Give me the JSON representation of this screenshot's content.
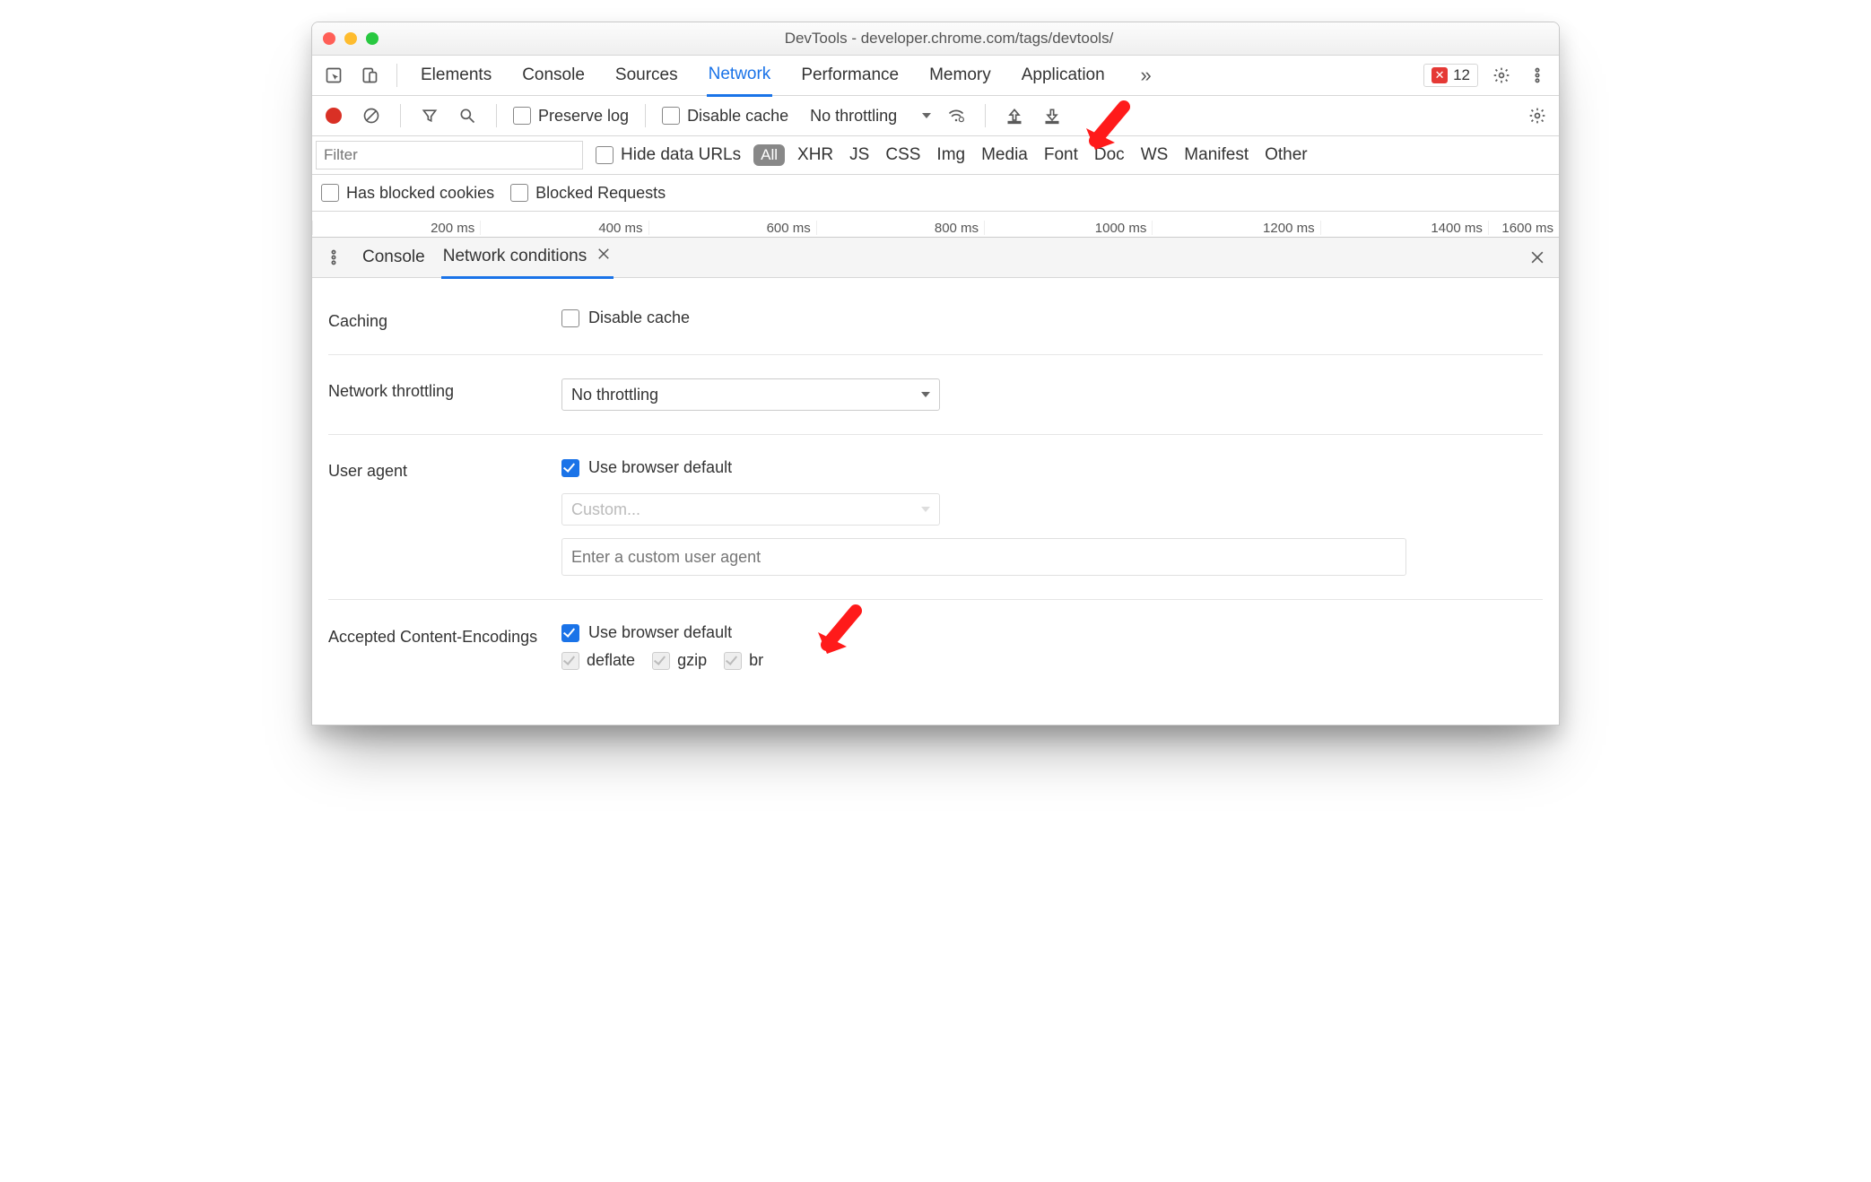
{
  "window": {
    "title": "DevTools - developer.chrome.com/tags/devtools/"
  },
  "tabs": {
    "elements": "Elements",
    "console": "Console",
    "sources": "Sources",
    "network": "Network",
    "performance": "Performance",
    "memory": "Memory",
    "application": "Application"
  },
  "errors": {
    "count": "12"
  },
  "toolbar": {
    "preserve_log": "Preserve log",
    "disable_cache": "Disable cache",
    "throttling": "No throttling"
  },
  "filter": {
    "placeholder": "Filter",
    "hide_data_urls": "Hide data URLs",
    "all": "All",
    "types": [
      "XHR",
      "JS",
      "CSS",
      "Img",
      "Media",
      "Font",
      "Doc",
      "WS",
      "Manifest",
      "Other"
    ]
  },
  "options": {
    "has_blocked_cookies": "Has blocked cookies",
    "blocked_requests": "Blocked Requests"
  },
  "timeline": [
    "200 ms",
    "400 ms",
    "600 ms",
    "800 ms",
    "1000 ms",
    "1200 ms",
    "1400 ms",
    "1600 ms"
  ],
  "drawer": {
    "console": "Console",
    "network_conditions": "Network conditions"
  },
  "panel": {
    "caching": "Caching",
    "caching_disable": "Disable cache",
    "throttling_label": "Network throttling",
    "throttling_value": "No throttling",
    "ua_label": "User agent",
    "ua_default": "Use browser default",
    "ua_custom": "Custom...",
    "ua_placeholder": "Enter a custom user agent",
    "enc_label": "Accepted Content-Encodings",
    "enc_default": "Use browser default",
    "enc": {
      "deflate": "deflate",
      "gzip": "gzip",
      "br": "br"
    }
  }
}
